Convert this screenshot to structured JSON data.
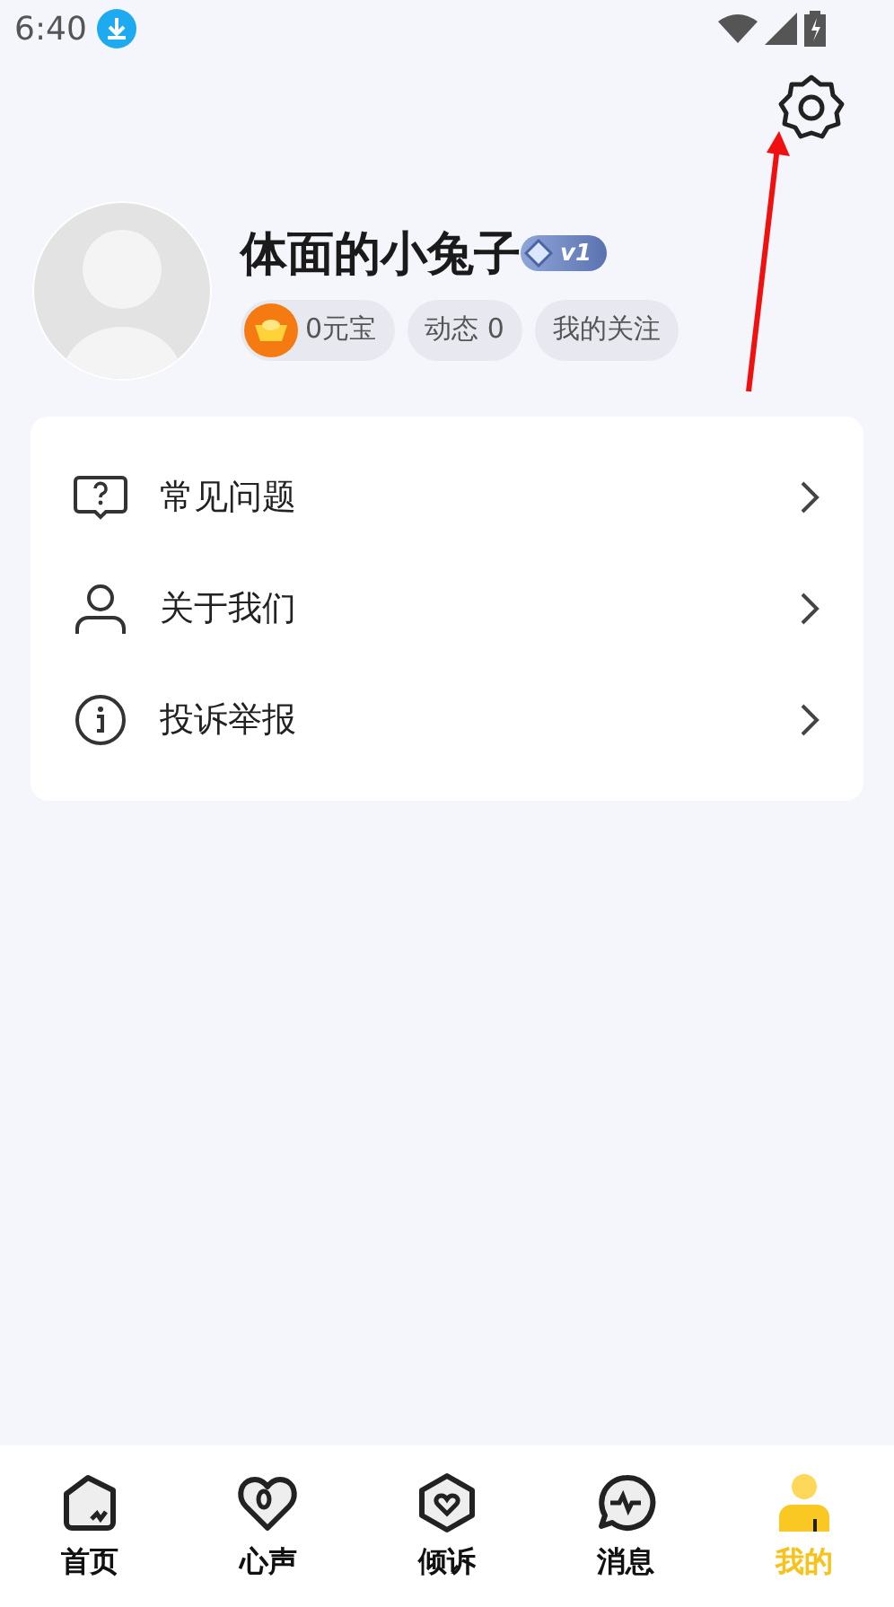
{
  "status_bar": {
    "time": "6:40"
  },
  "profile": {
    "name": "体面的小兔子",
    "level_badge": "v1",
    "chips": [
      {
        "kind": "coin",
        "label": "0元宝"
      },
      {
        "kind": "plain",
        "label": "动态 0"
      },
      {
        "kind": "plain",
        "label": "我的关注"
      }
    ]
  },
  "menu": [
    {
      "kind": "faq",
      "label": "常见问题"
    },
    {
      "kind": "about",
      "label": "关于我们"
    },
    {
      "kind": "report",
      "label": "投诉举报"
    }
  ],
  "tabs": [
    {
      "kind": "home",
      "label": "首页",
      "selected": false
    },
    {
      "kind": "heart",
      "label": "心声",
      "selected": false
    },
    {
      "kind": "shield",
      "label": "倾诉",
      "selected": false
    },
    {
      "kind": "chat",
      "label": "消息",
      "selected": false
    },
    {
      "kind": "me",
      "label": "我的",
      "selected": true
    }
  ]
}
